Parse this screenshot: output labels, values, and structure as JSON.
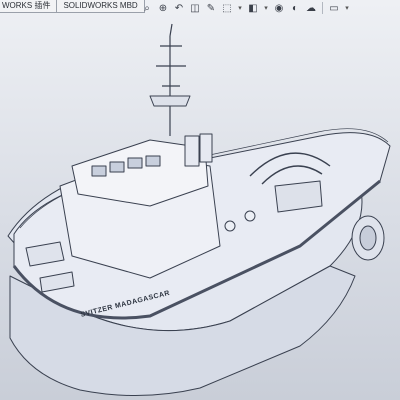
{
  "tabs": [
    {
      "label": "WORKS 插件"
    },
    {
      "label": "SOLIDWORKS MBD"
    }
  ],
  "heads_up_toolbar": [
    {
      "icon": "zoom-to-fit-icon",
      "glyph": "⌕"
    },
    {
      "icon": "zoom-to-area-icon",
      "glyph": "⊕"
    },
    {
      "icon": "previous-view-icon",
      "glyph": "↶"
    },
    {
      "icon": "section-view-icon",
      "glyph": "◫"
    },
    {
      "icon": "dynamic-annotation-icon",
      "glyph": "✎"
    },
    {
      "icon": "view-orientation-icon",
      "glyph": "⬚"
    },
    {
      "icon": "display-style-icon",
      "glyph": "◧"
    },
    {
      "icon": "hide-show-items-icon",
      "glyph": "◉"
    },
    {
      "icon": "edit-appearance-icon",
      "glyph": "◐"
    },
    {
      "icon": "apply-scene-icon",
      "glyph": "☁"
    },
    {
      "icon": "view-settings-icon",
      "glyph": "▭"
    }
  ],
  "model": {
    "hull_name": "SVITZER MADAGASCAR",
    "colors": {
      "hull": "#e6e9f2",
      "edge": "#3a4150",
      "deck": "#dfe3ee"
    }
  }
}
